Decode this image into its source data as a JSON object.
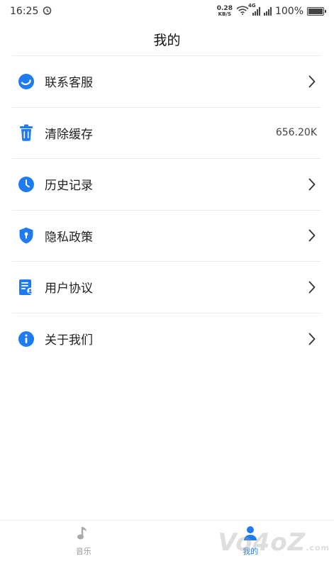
{
  "status_bar": {
    "time": "16:25",
    "speed_value": "0.28",
    "speed_unit": "KB/S",
    "network_tag": "4G",
    "battery": "100%"
  },
  "header": {
    "title": "我的"
  },
  "menu": {
    "items": [
      {
        "label": "联系客服",
        "icon": "customer-service-icon",
        "right": "chevron"
      },
      {
        "label": "清除缓存",
        "icon": "trash-icon",
        "right": "value",
        "value": "656.20K"
      },
      {
        "label": "历史记录",
        "icon": "clock-icon",
        "right": "chevron"
      },
      {
        "label": "隐私政策",
        "icon": "shield-lock-icon",
        "right": "chevron"
      },
      {
        "label": "用户协议",
        "icon": "document-icon",
        "right": "chevron"
      },
      {
        "label": "关于我们",
        "icon": "info-icon",
        "right": "chevron"
      }
    ]
  },
  "tabbar": {
    "tabs": [
      {
        "label": "音乐",
        "icon": "music-note-icon",
        "active": false
      },
      {
        "label": "我的",
        "icon": "person-icon",
        "active": true
      }
    ]
  },
  "watermark": {
    "text": "Vo4oZ",
    "suffix": ".com"
  },
  "colors": {
    "accent": "#1f7cf0",
    "divider": "#ececec",
    "inactive": "#999999"
  }
}
